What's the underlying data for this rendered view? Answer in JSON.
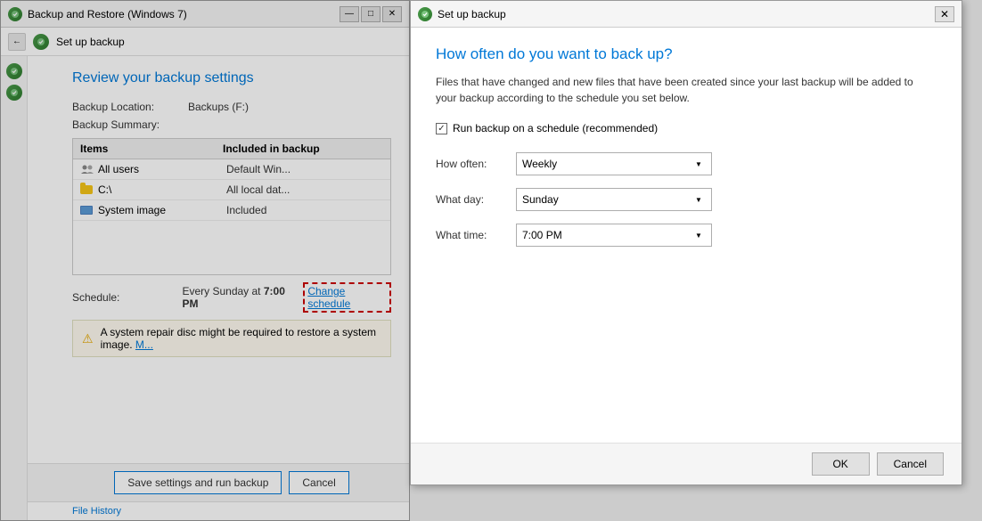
{
  "main_window": {
    "title": "Backup and Restore (Windows 7)",
    "nav_title": "Set up backup",
    "page_title": "Review your backup settings",
    "backup_location_label": "Backup Location:",
    "backup_location_value": "Backups (F:)",
    "backup_summary_label": "Backup Summary:",
    "table": {
      "col_items": "Items",
      "col_included": "Included in backup",
      "rows": [
        {
          "icon": "users",
          "name": "All users",
          "value": "Default Win..."
        },
        {
          "icon": "folder",
          "name": "C:\\",
          "value": "All local dat..."
        },
        {
          "icon": "computer",
          "name": "System image",
          "value": "Included"
        }
      ]
    },
    "schedule_label": "Schedule:",
    "schedule_value": "Every Sunday at",
    "schedule_time": "7:00 PM",
    "change_schedule_link": "Change schedule",
    "warning_text": "A system repair disc might be required to restore a system image.",
    "warning_link": "M...",
    "footer_save_btn": "Save settings and run backup",
    "footer_cancel_btn": "Cancel",
    "file_history_link": "File History"
  },
  "dialog": {
    "title": "Set up backup",
    "heading": "How often do you want to back up?",
    "description": "Files that have changed and new files that have been created since your last backup will be added to your backup according to the schedule you set below.",
    "checkbox_label": "Run backup on a schedule (recommended)",
    "checkbox_checked": true,
    "how_often_label": "How often:",
    "how_often_value": "Weekly",
    "what_day_label": "What day:",
    "what_day_value": "Sunday",
    "what_time_label": "What time:",
    "what_time_value": "7:00 PM",
    "ok_btn": "OK",
    "cancel_btn": "Cancel"
  }
}
